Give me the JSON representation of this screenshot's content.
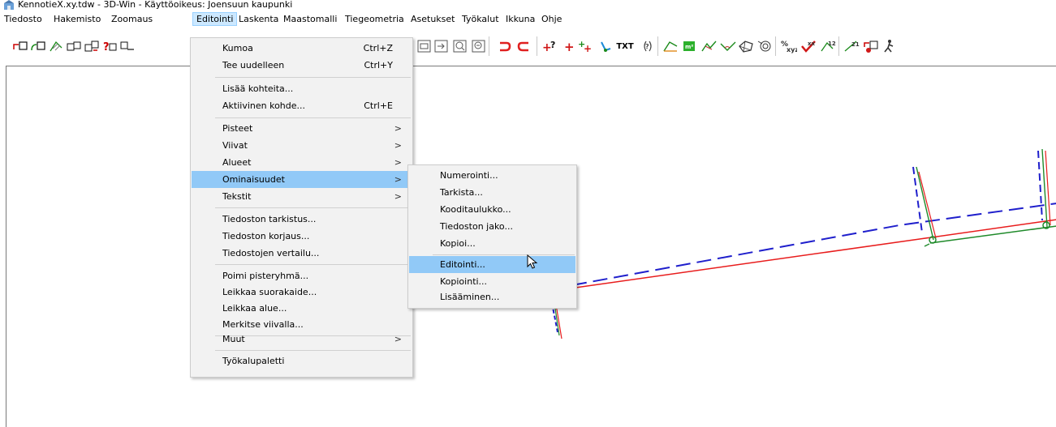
{
  "window": {
    "title": "KennotieX.xy.tdw - 3D-Win - Käyttöoikeus: Joensuun kaupunki"
  },
  "menubar": {
    "items": [
      {
        "label": "Tiedosto"
      },
      {
        "label": "Hakemisto"
      },
      {
        "label": "Zoomaus"
      },
      {
        "label": "Editointi"
      },
      {
        "label": "Laskenta"
      },
      {
        "label": "Maastomalli"
      },
      {
        "label": "Tiegeometria"
      },
      {
        "label": "Asetukset"
      },
      {
        "label": "Työkalut"
      },
      {
        "label": "Ikkuna"
      },
      {
        "label": "Ohje"
      }
    ],
    "active": "Editointi"
  },
  "toolbar": {
    "text_button": "TXT",
    "icons": [
      "new-point-icon",
      "new-point-2-icon",
      "hatch-icon",
      "copy-point-icon",
      "move-point-icon",
      "help-point-icon",
      "point-arrow-icon",
      "zoom-window-icon",
      "zoom-next-icon",
      "zoom-in-icon",
      "zoom-out-icon",
      "undo-icon",
      "redo-icon",
      "point-query-icon",
      "add-point-icon",
      "multi-point-icon",
      "line-tool-icon",
      "text-tool-icon",
      "spiral-icon",
      "area-icon",
      "measure-icon",
      "profile-icon",
      "angle-icon",
      "surface-icon",
      "circle-icon",
      "percent-icon",
      "check-icon",
      "scale-icon",
      "coordinate-icon",
      "transfer-icon",
      "walker-icon"
    ]
  },
  "editointi_menu": {
    "items": [
      {
        "label": "Kumoa",
        "shortcut": "Ctrl+Z"
      },
      {
        "label": "Tee uudelleen",
        "shortcut": "Ctrl+Y"
      },
      {
        "label": "Lisää kohteita..."
      },
      {
        "label": "Aktiivinen kohde...",
        "shortcut": "Ctrl+E"
      },
      {
        "label": "Pisteet",
        "submenu": true
      },
      {
        "label": "Viivat",
        "submenu": true
      },
      {
        "label": "Alueet",
        "submenu": true
      },
      {
        "label": "Ominaisuudet",
        "submenu": true,
        "highlighted": true
      },
      {
        "label": "Tekstit",
        "submenu": true
      },
      {
        "label": "Tiedoston tarkistus..."
      },
      {
        "label": "Tiedoston korjaus..."
      },
      {
        "label": "Tiedostojen vertailu..."
      },
      {
        "label": "Poimi pisteryhmä..."
      },
      {
        "label": "Leikkaa suorakaide..."
      },
      {
        "label": "Leikkaa alue..."
      },
      {
        "label": "Merkitse viivalla..."
      },
      {
        "label": "Muut",
        "submenu": true
      },
      {
        "label": "Työkalupaletti"
      }
    ]
  },
  "ominaisuudet_submenu": {
    "items": [
      {
        "label": "Numerointi..."
      },
      {
        "label": "Tarkista..."
      },
      {
        "label": "Kooditaulukko..."
      },
      {
        "label": "Tiedoston jako..."
      },
      {
        "label": "Kopioi..."
      },
      {
        "label": "Editointi...",
        "highlighted": true
      },
      {
        "label": "Kopiointi..."
      },
      {
        "label": "Lisääminen..."
      }
    ]
  },
  "colors": {
    "menu_highlight": "#91c9f7",
    "menubar_active": "#cce8ff",
    "drawing_red": "#e81c1c",
    "drawing_green": "#1f8a2a",
    "drawing_blue": "#1f1fcc"
  }
}
